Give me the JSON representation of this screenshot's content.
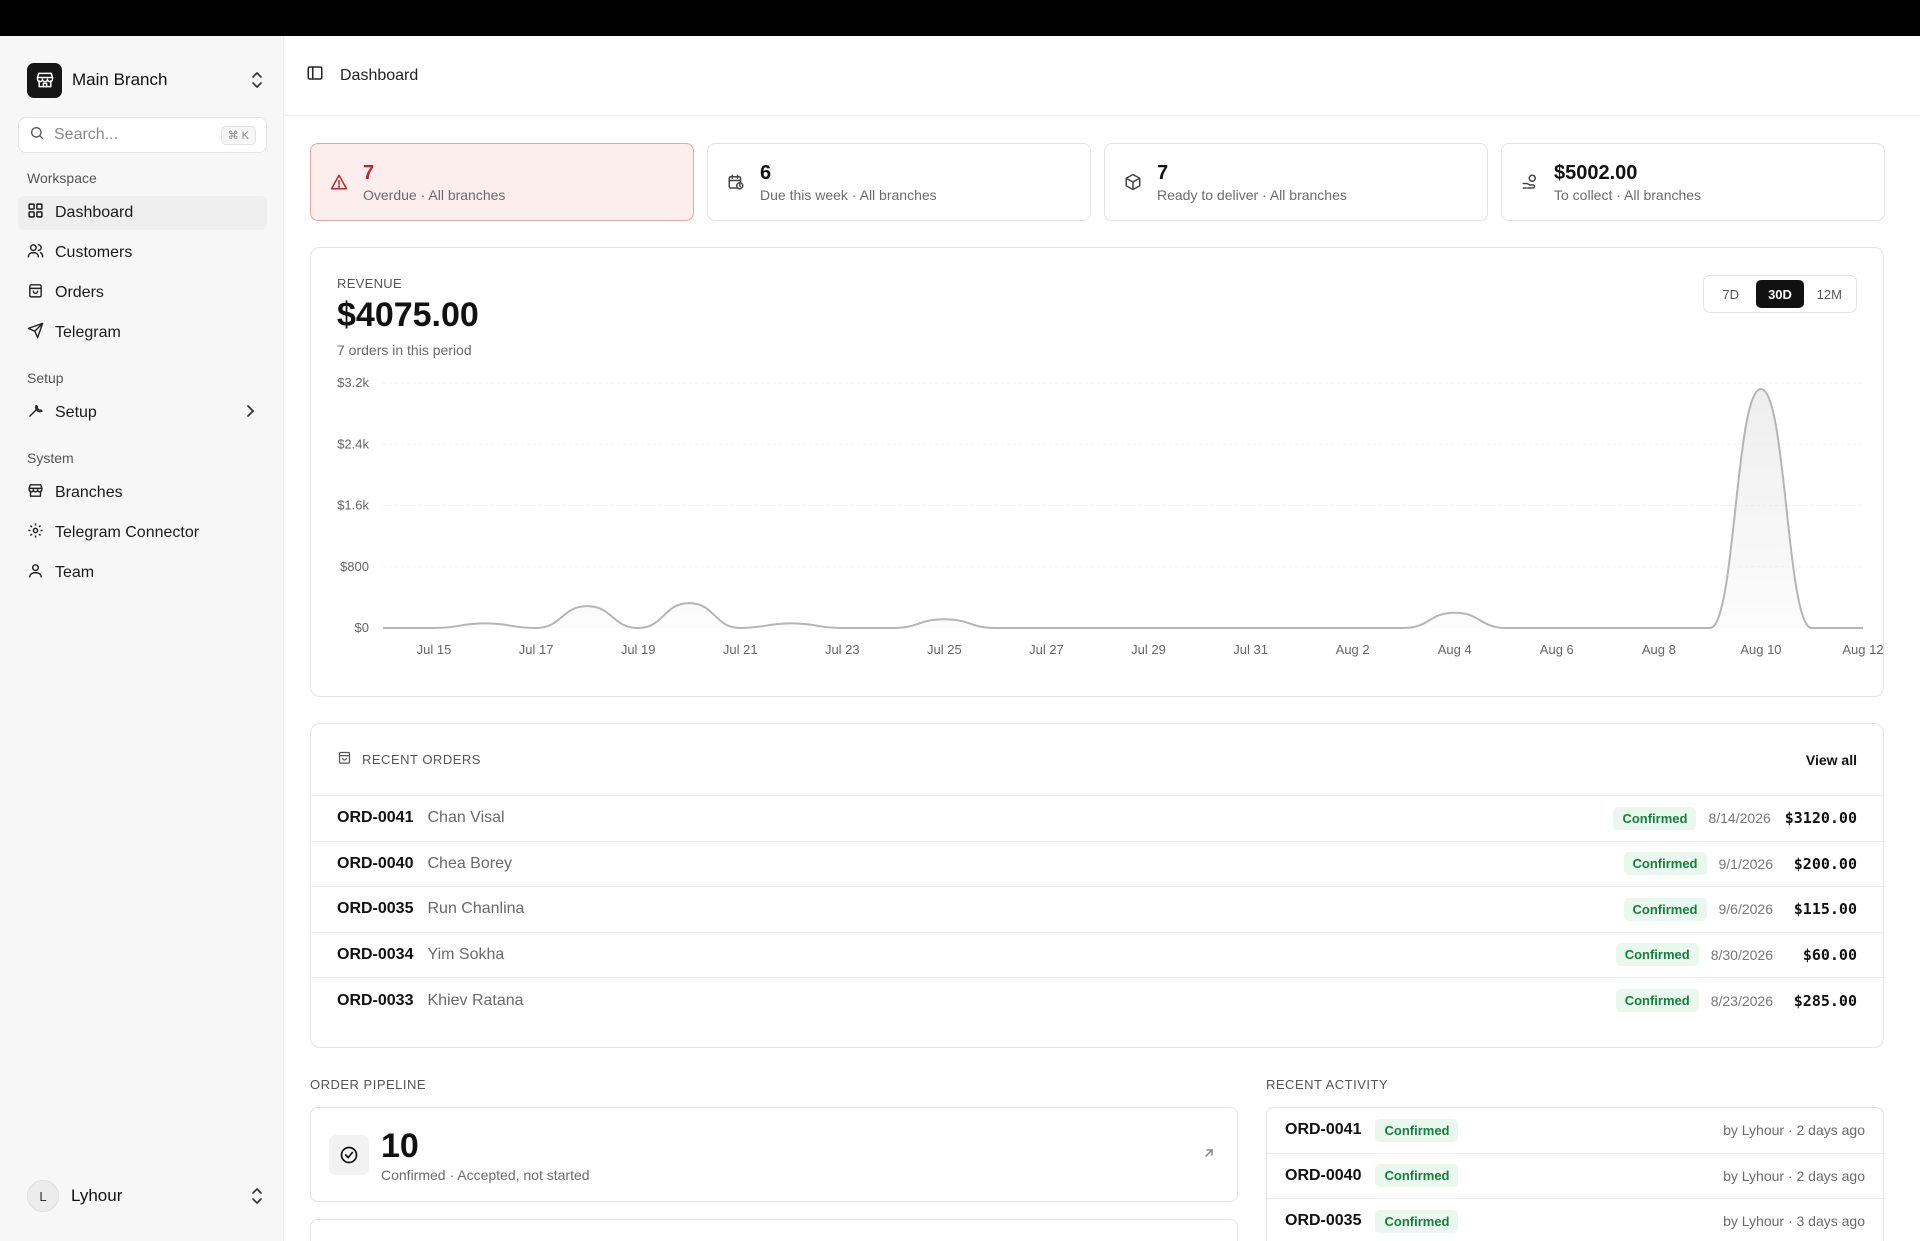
{
  "sidebar": {
    "branch": "Main Branch",
    "search_placeholder": "Search...",
    "search_shortcut": "⌘ K",
    "sections": {
      "workspace": "Workspace",
      "setup": "Setup",
      "system": "System"
    },
    "items": [
      {
        "label": "Dashboard",
        "icon": "grid-icon"
      },
      {
        "label": "Customers",
        "icon": "users-icon"
      },
      {
        "label": "Orders",
        "icon": "bag-icon"
      },
      {
        "label": "Telegram",
        "icon": "send-icon"
      },
      {
        "label": "Setup",
        "icon": "wrench-icon"
      },
      {
        "label": "Branches",
        "icon": "store-icon"
      },
      {
        "label": "Telegram Connector",
        "icon": "gear-icon"
      },
      {
        "label": "Team",
        "icon": "user-icon"
      }
    ],
    "user": {
      "initial": "L",
      "name": "Lyhour"
    }
  },
  "header": {
    "title": "Dashboard"
  },
  "stats": [
    {
      "value": "7",
      "sub": "Overdue · All branches",
      "icon": "alert-triangle-icon"
    },
    {
      "value": "6",
      "sub": "Due this week · All branches",
      "icon": "calendar-clock-icon"
    },
    {
      "value": "7",
      "sub": "Ready to deliver · All branches",
      "icon": "package-icon"
    },
    {
      "value": "$5002.00",
      "sub": "To collect · All branches",
      "icon": "hand-coins-icon"
    }
  ],
  "revenue": {
    "label": "REVENUE",
    "value": "$4075.00",
    "sub": "7 orders in this period",
    "ranges": [
      "7D",
      "30D",
      "12M"
    ],
    "active_range": "30D"
  },
  "chart_data": {
    "type": "area",
    "title": "",
    "xlabel": "",
    "ylabel": "",
    "ylim": [
      0,
      3200
    ],
    "y_ticks": [
      "$0",
      "$800",
      "$1.6k",
      "$2.4k",
      "$3.2k"
    ],
    "x_ticks": [
      "Jul 15",
      "Jul 17",
      "Jul 19",
      "Jul 21",
      "Jul 23",
      "Jul 25",
      "Jul 27",
      "Jul 29",
      "Jul 31",
      "Aug 2",
      "Aug 4",
      "Aug 6",
      "Aug 8",
      "Aug 10",
      "Aug 12"
    ],
    "grid": true,
    "legend": "none",
    "colors": {
      "line": "#b5b5b5",
      "fill": "#ececec",
      "grid": "#efefef"
    },
    "x": [
      "Jul 14",
      "Jul 15",
      "Jul 16",
      "Jul 17",
      "Jul 18",
      "Jul 19",
      "Jul 20",
      "Jul 21",
      "Jul 22",
      "Jul 23",
      "Jul 24",
      "Jul 25",
      "Jul 26",
      "Jul 27",
      "Jul 28",
      "Jul 29",
      "Jul 30",
      "Jul 31",
      "Aug 1",
      "Aug 2",
      "Aug 3",
      "Aug 4",
      "Aug 5",
      "Aug 6",
      "Aug 7",
      "Aug 8",
      "Aug 9",
      "Aug 10",
      "Aug 11",
      "Aug 12"
    ],
    "series": [
      {
        "values": [
          0,
          0,
          60,
          0,
          285,
          0,
          325,
          0,
          60,
          0,
          0,
          115,
          0,
          0,
          0,
          0,
          0,
          0,
          0,
          0,
          0,
          200,
          0,
          0,
          0,
          0,
          0,
          3120,
          0,
          0
        ]
      }
    ]
  },
  "recent_orders": {
    "title": "RECENT ORDERS",
    "view_all": "View all",
    "rows": [
      {
        "id": "ORD-0041",
        "name": "Chan Visal",
        "status": "Confirmed",
        "date": "8/14/2026",
        "amount": "$3120.00"
      },
      {
        "id": "ORD-0040",
        "name": "Chea Borey",
        "status": "Confirmed",
        "date": "9/1/2026",
        "amount": "$200.00"
      },
      {
        "id": "ORD-0035",
        "name": "Run Chanlina",
        "status": "Confirmed",
        "date": "9/6/2026",
        "amount": "$115.00"
      },
      {
        "id": "ORD-0034",
        "name": "Yim Sokha",
        "status": "Confirmed",
        "date": "8/30/2026",
        "amount": "$60.00"
      },
      {
        "id": "ORD-0033",
        "name": "Khiev Ratana",
        "status": "Confirmed",
        "date": "8/23/2026",
        "amount": "$285.00"
      }
    ]
  },
  "pipeline": {
    "title": "ORDER PIPELINE",
    "cards": [
      {
        "value": "10",
        "sub": "Confirmed · Accepted, not started",
        "icon": "check-circle-icon"
      }
    ]
  },
  "activity": {
    "title": "RECENT ACTIVITY",
    "rows": [
      {
        "id": "ORD-0041",
        "status": "Confirmed",
        "meta": "by Lyhour · 2 days ago"
      },
      {
        "id": "ORD-0040",
        "status": "Confirmed",
        "meta": "by Lyhour · 2 days ago"
      },
      {
        "id": "ORD-0035",
        "status": "Confirmed",
        "meta": "by Lyhour · 3 days ago"
      }
    ]
  }
}
